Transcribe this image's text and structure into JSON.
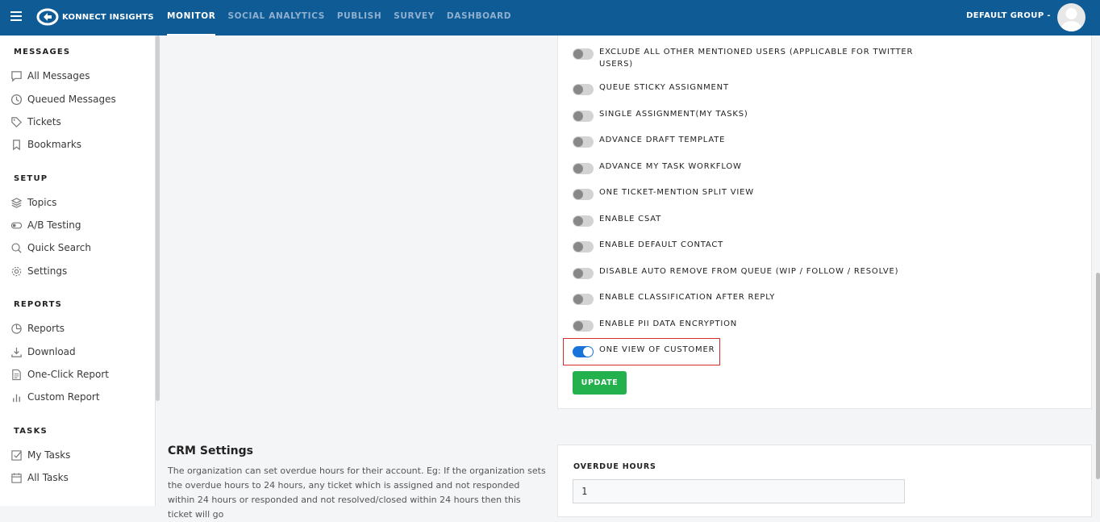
{
  "app": {
    "logo_text": "KONNECT INSIGHTS"
  },
  "topnav": [
    {
      "label": "MONITOR",
      "active": true
    },
    {
      "label": "SOCIAL ANALYTICS"
    },
    {
      "label": "PUBLISH"
    },
    {
      "label": "SURVEY"
    },
    {
      "label": "DASHBOARD"
    }
  ],
  "header": {
    "group_label": "DEFAULT GROUP -"
  },
  "sidebar": {
    "messages_title": "MESSAGES",
    "messages": [
      "All Messages",
      "Queued Messages",
      "Tickets",
      "Bookmarks"
    ],
    "setup_title": "SETUP",
    "setup": [
      "Topics",
      "A/B Testing",
      "Quick Search",
      "Settings"
    ],
    "reports_title": "REPORTS",
    "reports": [
      "Reports",
      "Download",
      "One-Click Report",
      "Custom Report"
    ],
    "tasks_title": "TASKS",
    "tasks": [
      "My Tasks",
      "All Tasks"
    ]
  },
  "settings": {
    "toggles": [
      {
        "label": "EXCLUDE ALL OTHER MENTIONED USERS (APPLICABLE FOR TWITTER USERS)",
        "on": false
      },
      {
        "label": "QUEUE STICKY ASSIGNMENT",
        "on": false
      },
      {
        "label": "SINGLE ASSIGNMENT(MY TASKS)",
        "on": false
      },
      {
        "label": "ADVANCE DRAFT TEMPLATE",
        "on": false
      },
      {
        "label": "ADVANCE MY TASK WORKFLOW",
        "on": false
      },
      {
        "label": "ONE TICKET-MENTION SPLIT VIEW",
        "on": false
      },
      {
        "label": "ENABLE CSAT",
        "on": false
      },
      {
        "label": "ENABLE DEFAULT CONTACT",
        "on": false
      },
      {
        "label": "DISABLE AUTO REMOVE FROM QUEUE (WIP / FOLLOW / RESOLVE)",
        "on": false
      },
      {
        "label": "ENABLE CLASSIFICATION AFTER REPLY",
        "on": false
      },
      {
        "label": "ENABLE PII DATA ENCRYPTION",
        "on": false
      },
      {
        "label": "ONE VIEW OF CUSTOMER",
        "on": true
      }
    ],
    "update_label": "UPDATE"
  },
  "crm": {
    "title": "CRM Settings",
    "description": "The organization can set overdue hours for their account. Eg: If the organization sets the overdue hours to 24 hours, any ticket which is assigned and not responded within 24 hours or responded and not resolved/closed within 24 hours then this ticket will go",
    "overdue_label": "OVERDUE HOURS",
    "overdue_value": "1"
  },
  "colors": {
    "topbar": "#0f5b96",
    "toggle_on": "#1a73d9",
    "update": "#22b14c",
    "highlight": "#d62b2b"
  }
}
